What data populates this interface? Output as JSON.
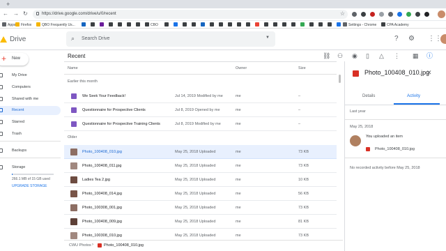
{
  "browser": {
    "new_tab": "+",
    "url": "https://drive.google.com/drive/u/0/recent",
    "bookmarks": {
      "apps": "Apps",
      "firefox": "Firefox",
      "qbo": "QBO Frequently Us...",
      "cbo": "CBO",
      "settings_chrome": "Settings - Chrome",
      "cpa_academy": "CPA Academy"
    }
  },
  "drive": {
    "app_name": "Drive",
    "search_placeholder": "Search Drive",
    "new_label": "New"
  },
  "sidebar": {
    "items": [
      {
        "label": "My Drive"
      },
      {
        "label": "Computers"
      },
      {
        "label": "Shared with me"
      },
      {
        "label": "Recent"
      },
      {
        "label": "Starred"
      },
      {
        "label": "Trash"
      },
      {
        "label": "Backups"
      },
      {
        "label": "Storage"
      }
    ],
    "storage_used": "266.1 MB of 15 GB used",
    "upgrade_label": "UPGRADE STORAGE"
  },
  "main": {
    "title": "Recent",
    "columns": {
      "name": "Name",
      "owner": "Owner",
      "size": "Size"
    },
    "sections": {
      "earlier": "Earlier this month",
      "older": "Older"
    },
    "rows": [
      {
        "name": "We Seek Your Feedback!",
        "modified": "Jul 14, 2019",
        "action": "Modified by me",
        "owner": "me",
        "size": "–"
      },
      {
        "name": "Questionnaire for Prospective Clients",
        "modified": "Jul 8, 2019",
        "action": "Opened by me",
        "owner": "me",
        "size": "–"
      },
      {
        "name": "Questionnaire for Prospective Training Clients",
        "modified": "Jul 8, 2019",
        "action": "Modified by me",
        "owner": "me",
        "size": "–"
      },
      {
        "name": "Photo_100408_010.jpg",
        "modified": "May 25, 2018",
        "action": "Uploaded",
        "owner": "me",
        "size": "73 KB"
      },
      {
        "name": "Photo_100408_011.jpg",
        "modified": "May 25, 2018",
        "action": "Uploaded",
        "owner": "me",
        "size": "73 KB"
      },
      {
        "name": "Ladies Tea 2.jpg",
        "modified": "May 25, 2018",
        "action": "Uploaded",
        "owner": "me",
        "size": "10 KB"
      },
      {
        "name": "Photo_100408_014.jpg",
        "modified": "May 25, 2018",
        "action": "Uploaded",
        "owner": "me",
        "size": "56 KB"
      },
      {
        "name": "Photo_100308_001.jpg",
        "modified": "May 25, 2018",
        "action": "Uploaded",
        "owner": "me",
        "size": "73 KB"
      },
      {
        "name": "Photo_100408_009.jpg",
        "modified": "May 25, 2018",
        "action": "Uploaded",
        "owner": "me",
        "size": "81 KB"
      },
      {
        "name": "Photo_100308_010.jpg",
        "modified": "May 25, 2018",
        "action": "Uploaded",
        "owner": "me",
        "size": "73 KB"
      }
    ],
    "breadcrumb": {
      "folder": "CWU Photos",
      "file": "Photo_100408_010.jpg"
    }
  },
  "details": {
    "title": "Photo_100408_010.jpg",
    "tabs": {
      "details": "Details",
      "activity": "Activity"
    },
    "last_year": "Last year",
    "date": "May 25, 2018",
    "actor": "You",
    "action_text": " uploaded an item",
    "file": "Photo_100408_010.jpg",
    "none_note": "No recorded activity before May 25, 2018"
  },
  "colors": {
    "accent": "#1a73e8",
    "selected_bg": "#e8f0fe",
    "form_purple": "#7e57c2",
    "image_red": "#d93025"
  }
}
